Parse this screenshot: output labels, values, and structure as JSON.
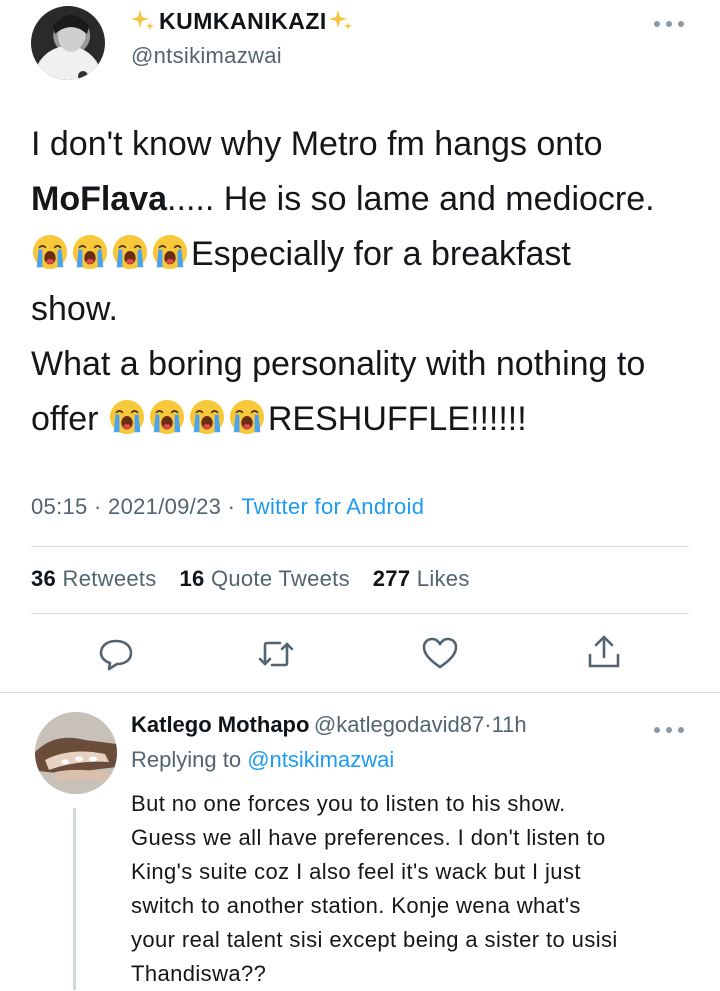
{
  "tweet": {
    "author_name": "KUMKANIKAZI",
    "author_handle": "@ntsikimazwai",
    "line1": "I don't know why Metro fm hangs onto",
    "line2_bold": "MoFlava",
    "line2_rest": "..... He is so lame and mediocre.",
    "line3_rest": "Especially for a breakfast",
    "line4": "show.",
    "line5": "What a boring personality with nothing to",
    "line6_start": "offer ",
    "line6_end": "RESHUFFLE!!!!!!",
    "emoji_name": "loudly-crying-face",
    "time": "05:15",
    "date": "2021/09/23",
    "separator": "·",
    "source": "Twitter for Android"
  },
  "stats": {
    "retweets_count": "36",
    "retweets_label": "Retweets",
    "quotes_count": "16",
    "quotes_label": "Quote Tweets",
    "likes_count": "277",
    "likes_label": "Likes"
  },
  "actions": [
    "reply-icon",
    "retweet-icon",
    "like-icon",
    "share-icon"
  ],
  "reply": {
    "name": "Katlego Mothapo",
    "handle": "@katlegodavid87",
    "separator": "·",
    "time": "11h",
    "replying_label": "Replying to",
    "replying_handle": "@ntsikimazwai",
    "lines": [
      "But no one forces you to listen to his show.",
      "Guess we all have preferences. I don't listen to",
      "King's suite coz I also feel it's wack but I just",
      "switch to another station. Konje wena what's",
      "your real talent sisi except being a sister to usisi",
      "Thandiswa??"
    ]
  },
  "colors": {
    "accent": "#1d9bf0",
    "secondary_text": "#536471",
    "divider": "#d7dde2"
  }
}
